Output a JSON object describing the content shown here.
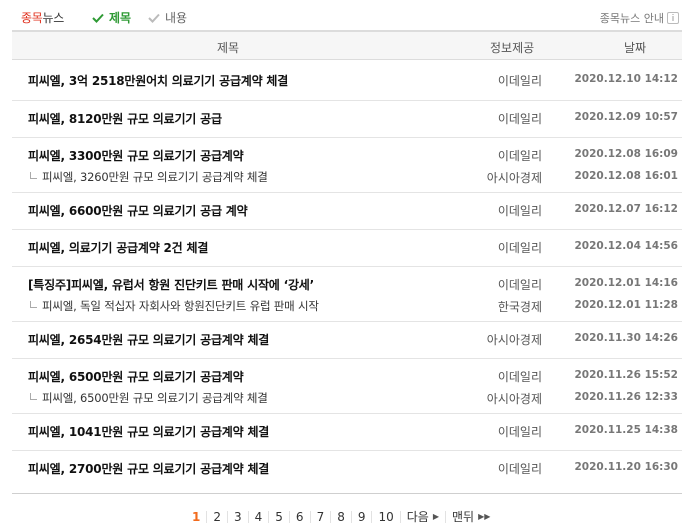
{
  "topbar": {
    "tab_accent": "종목",
    "tab_rest": "뉴스",
    "filter_title": "제목",
    "filter_content": "내용",
    "guide": "종목뉴스 안내"
  },
  "table": {
    "headers": {
      "title": "제목",
      "source": "정보제공",
      "date": "날짜"
    },
    "rows": [
      {
        "title": "피씨엘, 3억 2518만원어치 의료기기 공급계약 체결",
        "source": "이데일리",
        "date": "2020.12.10 14:12"
      },
      {
        "title": "피씨엘, 8120만원 규모 의료기기 공급",
        "source": "이데일리",
        "date": "2020.12.09 10:57"
      },
      {
        "title": "피씨엘, 3300만원 규모 의료기기 공급계약",
        "source": "이데일리",
        "date": "2020.12.08 16:09",
        "related": {
          "title": "피씨엘, 3260만원 규모 의료기기 공급계약 체결",
          "source": "아시아경제",
          "date": "2020.12.08 16:01"
        }
      },
      {
        "title": "피씨엘, 6600만원 규모 의료기기 공급 계약",
        "source": "이데일리",
        "date": "2020.12.07 16:12"
      },
      {
        "title": "피씨엘, 의료기기 공급계약 2건 체결",
        "source": "이데일리",
        "date": "2020.12.04 14:56"
      },
      {
        "title": "[특징주]피씨엘, 유럽서 항원 진단키트 판매 시작에 ‘강세’",
        "source": "이데일리",
        "date": "2020.12.01 14:16",
        "related": {
          "title": "피씨엘, 독일 적십자 자회사와 항원진단키트 유럽 판매 시작",
          "source": "한국경제",
          "date": "2020.12.01 11:28"
        }
      },
      {
        "title": "피씨엘, 2654만원 규모 의료기기 공급계약 체결",
        "source": "아시아경제",
        "date": "2020.11.30 14:26"
      },
      {
        "title": "피씨엘, 6500만원 규모 의료기기 공급계약",
        "source": "이데일리",
        "date": "2020.11.26 15:52",
        "related": {
          "title": "피씨엘, 6500만원 규모 의료기기 공급계약 체결",
          "source": "아시아경제",
          "date": "2020.11.26 12:33"
        }
      },
      {
        "title": "피씨엘, 1041만원 규모 의료기기 공급계약 체결",
        "source": "이데일리",
        "date": "2020.11.25 14:38"
      },
      {
        "title": "피씨엘, 2700만원 규모 의료기기 공급계약 체결",
        "source": "이데일리",
        "date": "2020.11.20 16:30"
      }
    ]
  },
  "pagination": {
    "pages": [
      "1",
      "2",
      "3",
      "4",
      "5",
      "6",
      "7",
      "8",
      "9",
      "10"
    ],
    "current": "1",
    "next_label": "다음",
    "last_label": "맨뒤"
  },
  "colors": {
    "accent_red": "#e0301e",
    "check_green": "#2e9a34",
    "current_page": "#f26b1d"
  },
  "icons": {
    "filter_title": "check-icon",
    "filter_content": "check-icon",
    "guide": "info-icon",
    "next": "arrow-right-icon",
    "last": "double-arrow-right-icon"
  }
}
